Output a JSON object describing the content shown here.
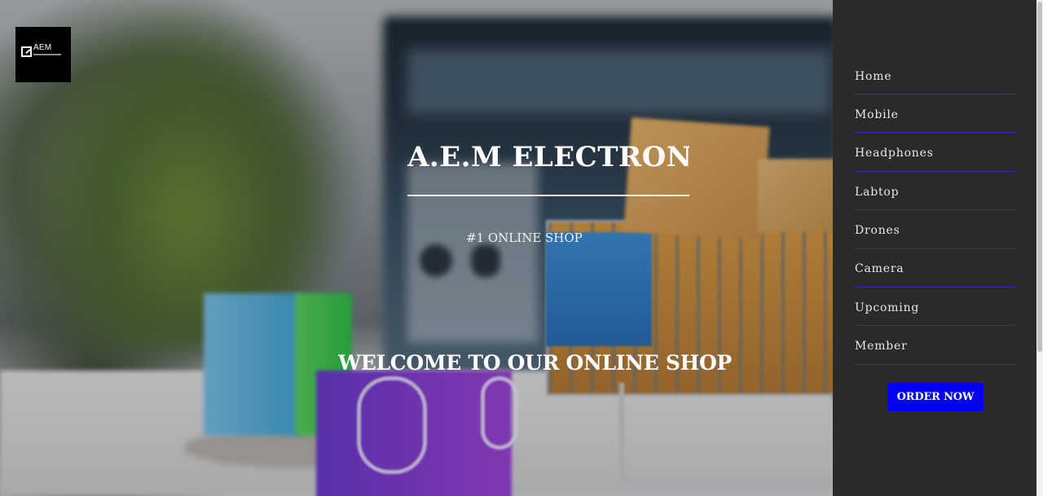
{
  "logo": {
    "text": "AEM"
  },
  "hero": {
    "brand_title": "A.E.M ELECTRONICS",
    "tagline": "#1 ONLINE SHOP",
    "welcome": "WELCOME TO OUR ONLINE SHOP"
  },
  "nav": {
    "items": [
      {
        "label": "Home"
      },
      {
        "label": "Mobile"
      },
      {
        "label": "Headphones"
      },
      {
        "label": "Labtop"
      },
      {
        "label": "Drones"
      },
      {
        "label": "Camera"
      },
      {
        "label": "Upcoming"
      },
      {
        "label": "Member"
      }
    ],
    "order_button": "ORDER NOW"
  },
  "colors": {
    "sidebar_bg": "#2c2a29",
    "nav_divider": "#2b2bcf",
    "order_button_bg": "#0000f2",
    "hero_text": "#ffffff"
  },
  "icons": {
    "logo_mark": "edit-square-icon"
  }
}
